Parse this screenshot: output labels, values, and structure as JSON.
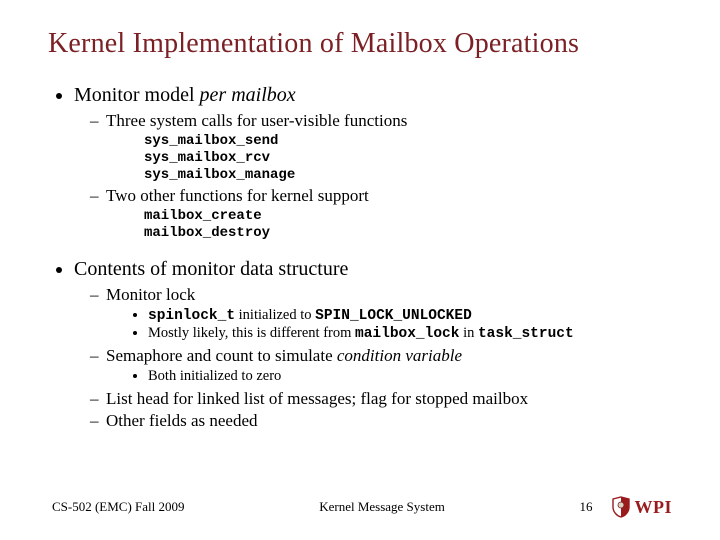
{
  "title": "Kernel Implementation of Mailbox Operations",
  "bullets": [
    {
      "text_pre": "Monitor model ",
      "text_ital": "per mailbox",
      "sub": [
        {
          "text": "Three system calls for user-visible functions",
          "code": [
            "sys_mailbox_send",
            "sys_mailbox_rcv",
            "sys_mailbox_manage"
          ]
        },
        {
          "text": "Two other functions for kernel support",
          "code": [
            "mailbox_create",
            "mailbox_destroy"
          ]
        }
      ]
    },
    {
      "text": "Contents of monitor data structure",
      "sub": [
        {
          "text": "Monitor lock",
          "sub_bullets": [
            {
              "seg1_mono": "spinlock_t",
              "seg1_rest": " initialized to ",
              "seg1_mono2": "SPIN_LOCK_UNLOCKED"
            },
            {
              "seg2_pre": "Mostly likely, this is different from ",
              "seg2_mono1": "mailbox_lock",
              "seg2_mid": " in ",
              "seg2_mono2": "task_struct"
            }
          ]
        },
        {
          "text_pre": "Semaphore and count to simulate ",
          "text_ital": "condition variable",
          "sub_bullets": [
            {
              "plain": "Both initialized to zero"
            }
          ]
        },
        {
          "text": "List head for linked list of messages; flag for stopped mailbox"
        },
        {
          "text": "Other fields as needed"
        }
      ]
    }
  ],
  "footer": {
    "left": "CS-502 (EMC) Fall 2009",
    "center": "Kernel Message System",
    "page": "16",
    "logo_text": "WPI"
  }
}
